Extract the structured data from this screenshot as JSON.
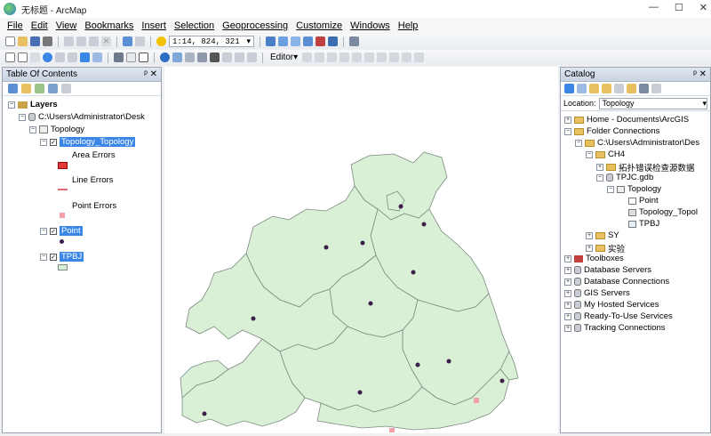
{
  "window": {
    "title": "无标题 - ArcMap"
  },
  "menu": [
    "File",
    "Edit",
    "View",
    "Bookmarks",
    "Insert",
    "Selection",
    "Geoprocessing",
    "Customize",
    "Windows",
    "Help"
  ],
  "toolbar": {
    "scale": "1:14, 824, 321",
    "editor_label": "Editor▾"
  },
  "toc": {
    "title": "Table Of Contents",
    "layers_label": "Layers",
    "path": "C:\\Users\\Administrator\\Desk",
    "dataset": "Topology",
    "topology_layer": "Topology_Topology",
    "area_errors": "Area Errors",
    "line_errors": "Line Errors",
    "point_errors": "Point Errors",
    "point_layer": "Point",
    "tpbj_layer": "TPBJ"
  },
  "catalog": {
    "title": "Catalog",
    "location_label": "Location:",
    "location_value": "Topology",
    "items": {
      "home": "Home - Documents\\ArcGIS",
      "folder_connections": "Folder Connections",
      "admin_path": "C:\\Users\\Administrator\\Des",
      "ch4": "CH4",
      "chinese_folder": "拓扑错误检查源数据",
      "gdb": "TPJC.gdb",
      "topology": "Topology",
      "point": "Point",
      "topology_topol": "Topology_Topol",
      "tpbj": "TPBJ",
      "sy": "SY",
      "shiyan": "实验",
      "toolboxes": "Toolboxes",
      "database_servers": "Database Servers",
      "database_connections": "Database Connections",
      "gis_servers": "GIS Servers",
      "hosted_services": "My Hosted Services",
      "ready_to_use": "Ready-To-Use Services",
      "tracking": "Tracking Connections"
    }
  },
  "colors": {
    "polygon_fill": "#d9f0d6",
    "polygon_stroke": "#7c8a80",
    "point": "#3b1f4a",
    "error": "#f4a0a8",
    "selection": "#3a86e6"
  }
}
